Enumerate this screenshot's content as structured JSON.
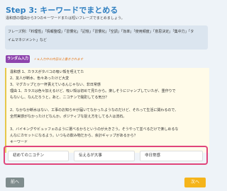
{
  "step": {
    "title": "Step 3: キーワードでまとめる",
    "description": "違和感の理由から3つのキーワードまたは短いフレーズでまとめましょう。"
  },
  "phrases": {
    "line1": "フレーズ例：「料理性」「情報整理」「習慣化」「記憶」「習慣化」「空調」「効率」「使用頻度」「意思決定」「集中力」「タ",
    "line2": "イムマネジメント」など"
  },
  "random_button": {
    "label": "ランダム入力",
    "note": "※入力中の内容は上書きされます"
  },
  "answer": {
    "head": "違和感",
    "lines": [
      "違和感 1、カラスがタバコの吸い殻を咥えてた",
      "2、友人が断水、色々あったけど大変",
      "3、マグカップとか一杯貰えているんじゃない、非日常感",
      "理由 1、カラスは色々加えるけど、吸い殻は初めて見たから。楽しそうにジャンプしていたが、重作りで",
      "もないし、なんだろうと。あと、ニコチンで酩酊してる気分？",
      "",
      "2、なかなか断水はない、工事のお知らせが届いてなかったようなのだけど、それって生活に関わるので、",
      "全然実感がなかったけどなんか。ポジティブな捉え方をしてる人は流石。",
      "",
      "3、バイキングやビュッフェのように選べるからというのが大きさう。そうやって並べるだけで楽しめるな",
      "んなにカセットになるよう。いつもの飲み物だから、余計ギャップがあるから？",
      "キーワード"
    ]
  },
  "keywords": {
    "k1": "初めてのニコチン",
    "k2": "伝えるが大事",
    "k3": "非日常感"
  },
  "nav": {
    "prev_label": "前へ",
    "next_label": "次へ"
  },
  "colors": {
    "title": "#2f7fc0",
    "random_button": "#8e44ad",
    "note": "#e67e22",
    "highlight_border": "#e0457b",
    "next_button": "#f5b41b",
    "prev_button": "#7f8c8d"
  }
}
